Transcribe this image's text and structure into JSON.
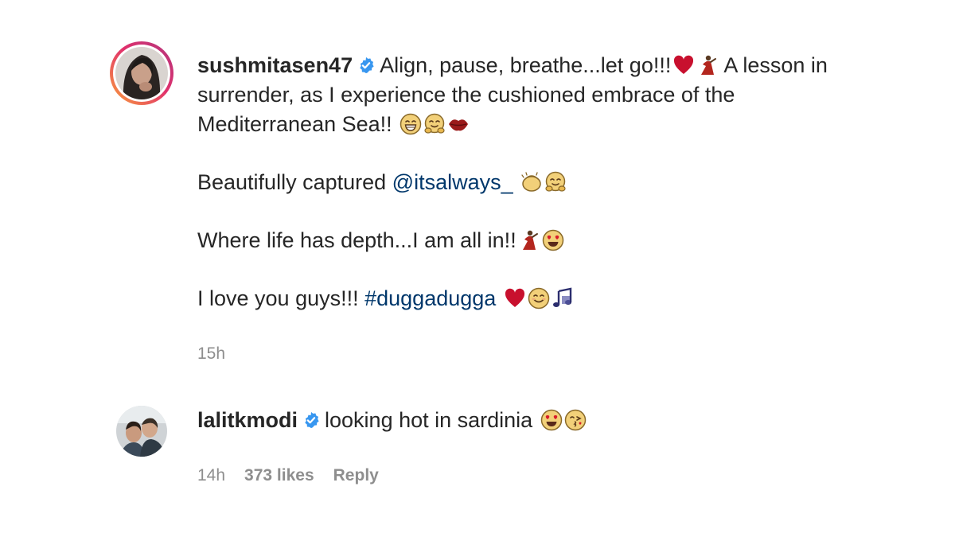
{
  "post": {
    "username": "sushmitasen47",
    "line1": "Align, pause, breathe...let go!!!",
    "line1_tail": "A lesson in surrender, as I experience the cushioned embrace of the Mediterranean Sea!!",
    "para2_text": "Beautifully captured ",
    "para2_mention": "@itsalways_",
    "para3_text": "Where life has depth...I am all in!!",
    "para4_text": "I love you guys!!! ",
    "para4_hashtag": "#duggadugga",
    "time": "15h"
  },
  "comment": {
    "username": "lalitkmodi",
    "text": "looking hot in sardinia",
    "time": "14h",
    "likes": "373 likes",
    "reply": "Reply"
  },
  "colors": {
    "text": "#262626",
    "meta": "#8e8e8e",
    "link": "#00376b",
    "verified": "#3897f0"
  },
  "icons": {
    "verified": "verified-badge-icon",
    "heart": "red-heart-emoji-icon",
    "dancer": "dancer-emoji-icon",
    "grin": "grinning-emoji-icon",
    "hug": "hugging-face-emoji-icon",
    "kiss": "kiss-lips-emoji-icon",
    "clap": "clapping-hands-emoji-icon",
    "heart_eyes": "heart-eyes-emoji-icon",
    "smile": "smiling-face-emoji-icon",
    "music": "musical-notes-emoji-icon",
    "wink_kiss": "face-blowing-kiss-emoji-icon"
  }
}
